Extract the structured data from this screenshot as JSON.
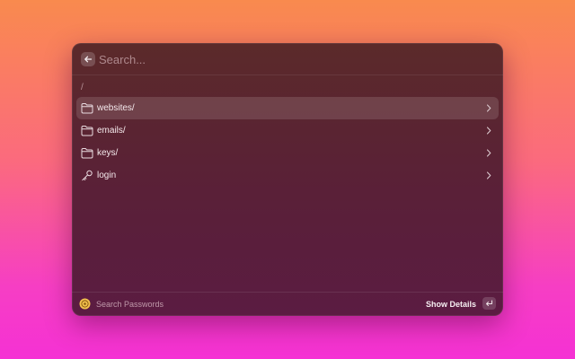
{
  "search": {
    "placeholder": "Search...",
    "value": ""
  },
  "path": "/",
  "items": [
    {
      "label": "websites/",
      "icon": "folder-icon",
      "selected": true
    },
    {
      "label": "emails/",
      "icon": "folder-icon",
      "selected": false
    },
    {
      "label": "keys/",
      "icon": "folder-icon",
      "selected": false
    },
    {
      "label": "login",
      "icon": "key-icon",
      "selected": false
    }
  ],
  "footer": {
    "title": "Search Passwords",
    "action_label": "Show Details",
    "action_key_icon": "enter-key-icon",
    "logo_icon": "app-logo-icon"
  },
  "colors": {
    "accent_logo": "#f2c14e",
    "window_top": "#5b2a2a",
    "window_bottom": "#5b1c42"
  }
}
